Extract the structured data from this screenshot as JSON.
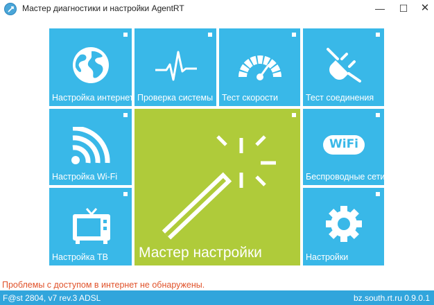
{
  "window": {
    "title": "Мастер диагностики и настройки AgentRT",
    "minimize": "—",
    "maximize": "☐",
    "close": "✕"
  },
  "tiles": {
    "internet_setup": {
      "label": "Настройка интернет",
      "icon": "globe-icon"
    },
    "system_check": {
      "label": "Проверка системы",
      "icon": "pulse-icon"
    },
    "speed_test": {
      "label": "Тест скорости",
      "icon": "speedometer-icon"
    },
    "connection_test": {
      "label": "Тест соединения",
      "icon": "plug-icon"
    },
    "wifi_setup": {
      "label": "Настройка Wi-Fi",
      "icon": "wifi-icon"
    },
    "setup_wizard": {
      "label": "Мастер настройки",
      "icon": "magic-wand-icon"
    },
    "wireless_networks": {
      "label": "Беспроводные сети",
      "icon": "wifi-badge-icon",
      "badge": "WiFi"
    },
    "tv_setup": {
      "label": "Настройка ТВ",
      "icon": "tv-icon"
    },
    "settings": {
      "label": "Настройки",
      "icon": "gear-icon"
    }
  },
  "status": {
    "message": "Проблемы с доступом в интернет не обнаружены.",
    "device": "F@st 2804, v7 rev.3 ADSL",
    "server_version": "bz.south.rt.ru  0.9.0.1"
  },
  "colors": {
    "tile_blue": "#39b8e8",
    "tile_green": "#afcb3a",
    "status_bar": "#31a5dc",
    "status_message": "#e0522a"
  }
}
